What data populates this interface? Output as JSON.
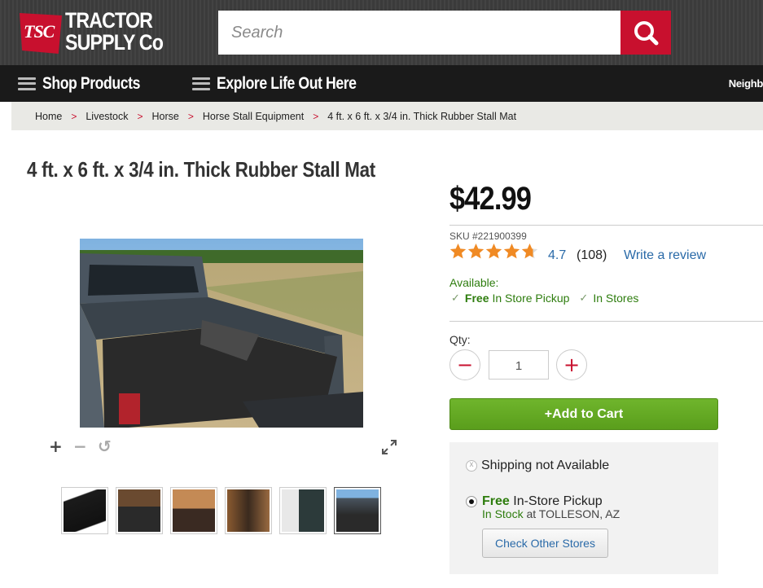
{
  "header": {
    "logo_badge": "TSC",
    "logo_line1": "TRACTOR",
    "logo_line2": "SUPPLY Co",
    "search_placeholder": "Search"
  },
  "nav": {
    "shop_products": "Shop Products",
    "explore": "Explore Life Out Here",
    "right_partial": "Neighb"
  },
  "breadcrumb": [
    "Home",
    "Livestock",
    "Horse",
    "Horse Stall Equipment",
    "4 ft. x 6 ft. x 3/4 in. Thick Rubber Stall Mat"
  ],
  "product": {
    "title": "4 ft. x 6 ft. x 3/4 in. Thick Rubber Stall Mat",
    "price": "$42.99",
    "sku": "SKU #221900399",
    "rating": "4.7",
    "rating_value": 4.7,
    "review_count": "(108)",
    "write_review": "Write a review",
    "available_label": "Available:",
    "avail_free": "Free",
    "avail_pickup": "In Store Pickup",
    "avail_stores": "In Stores",
    "qty_label": "Qty:",
    "qty_value": "1",
    "add_to_cart": "+Add to Cart"
  },
  "fulfillment": {
    "shipping": "Shipping not Available",
    "pickup_free": "Free",
    "pickup_label": "In-Store Pickup",
    "stock_status": "In Stock",
    "stock_location": "at TOLLESON, AZ",
    "check_other": "Check Other Stores"
  },
  "colors": {
    "brand_red": "#c8102e",
    "cart_green": "#5a9e1c",
    "link_blue": "#2a6aa8",
    "star_orange": "#f08a24"
  }
}
